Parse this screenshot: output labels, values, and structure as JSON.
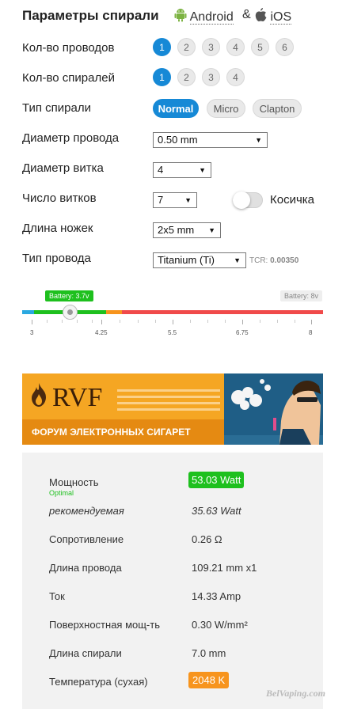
{
  "header": {
    "title": "Параметры спирали",
    "android_label": "Android",
    "amp": "&",
    "ios_label": "iOS"
  },
  "rows": {
    "wires_label": "Кол-во проводов",
    "wires_options": [
      "1",
      "2",
      "3",
      "4",
      "5",
      "6"
    ],
    "wires_selected": "1",
    "coils_label": "Кол-во спиралей",
    "coils_options": [
      "1",
      "2",
      "3",
      "4"
    ],
    "coils_selected": "1",
    "type_label": "Тип спирали",
    "type_options": [
      "Normal",
      "Micro",
      "Clapton"
    ],
    "type_selected": "Normal",
    "diameter_label": "Диаметр провода",
    "diameter_value": "0.50 mm",
    "coil_diam_label": "Диаметр витка",
    "coil_diam_value": "4",
    "turns_label": "Число витков",
    "turns_value": "7",
    "braid_label": "Косичка",
    "braid_on": false,
    "legs_label": "Длина ножек",
    "legs_value": "2x5 mm",
    "wire_type_label": "Тип провода",
    "wire_type_value": "Titanium (Ti)",
    "tcr_label": "TCR:",
    "tcr_value": "0.00350"
  },
  "battery": {
    "current_badge": "Battery: 3.7v",
    "max_badge": "Battery: 8v",
    "value": 3.7,
    "min": 3,
    "max": 8,
    "ticks": [
      "3",
      "4.25",
      "5.5",
      "6.75",
      "8"
    ],
    "colors": {
      "blue": "#2aa8e0",
      "green": "#1ec01e",
      "orange": "#f7941d",
      "red": "#f04a4a"
    }
  },
  "banner": {
    "logo_text": "RVF",
    "caption": "ФОРУМ ЭЛЕКТРОННЫХ СИГАРЕТ"
  },
  "results": {
    "power_label": "Мощность",
    "power_status": "Optimal",
    "power_value": "53.03 Watt",
    "recommended_label": "рекомендуемая",
    "recommended_value": "35.63 Watt",
    "resistance_label": "Сопротивление",
    "resistance_value": "0.26 Ω",
    "wire_length_label": "Длина провода",
    "wire_length_value": "109.21 mm x1",
    "current_label": "Ток",
    "current_value": "14.33 Amp",
    "surface_label": "Поверхностная мощ-ть",
    "surface_value": "0.30 W/mm²",
    "coil_length_label": "Длина спирали",
    "coil_length_value": "7.0 mm",
    "temp_label": "Температура (сухая)",
    "temp_value": "2048 K"
  },
  "watermark": "BelVaping.com"
}
